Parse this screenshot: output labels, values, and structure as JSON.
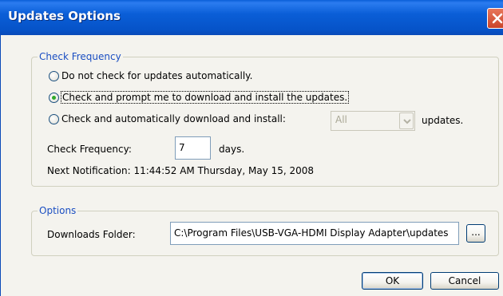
{
  "window": {
    "title": "Updates Options"
  },
  "check_frequency": {
    "legend": "Check Frequency",
    "options": [
      {
        "label": "Do not check for updates automatically.",
        "checked": false
      },
      {
        "label": "Check and prompt me to download and install the updates.",
        "checked": true
      },
      {
        "label": "Check and automatically download and install:",
        "checked": false
      }
    ],
    "auto_install_select": {
      "value": "All",
      "suffix": "updates."
    },
    "frequency": {
      "label": "Check Frequency:",
      "value": "7",
      "unit": "days."
    },
    "next_notification": "Next Notification: 11:44:52 AM Thursday, May 15, 2008"
  },
  "options": {
    "legend": "Options",
    "downloads_folder": {
      "label": "Downloads Folder:",
      "value": "C:\\Program Files\\USB-VGA-HDMI Display Adapter\\updates",
      "browse_label": "..."
    }
  },
  "buttons": {
    "ok": "OK",
    "cancel": "Cancel"
  },
  "colors": {
    "titlebar": "#0a5ed7",
    "close": "#c9442a",
    "group_legend": "#1a4ec2",
    "radio_selected": "#2fa92a"
  }
}
